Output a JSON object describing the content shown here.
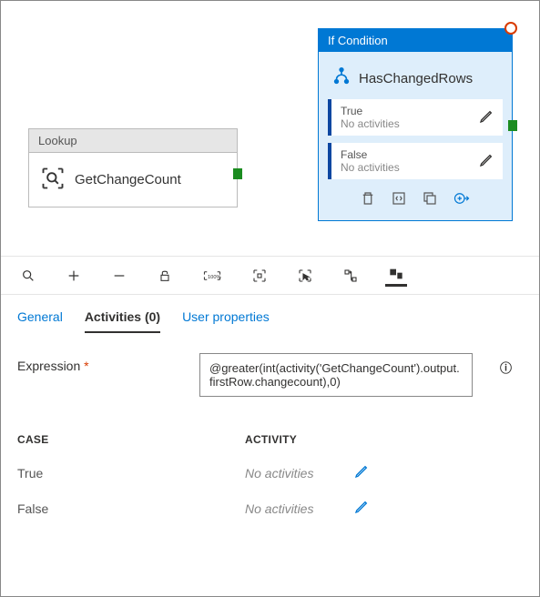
{
  "canvas": {
    "lookup": {
      "type_label": "Lookup",
      "name": "GetChangeCount"
    },
    "if_condition": {
      "type_label": "If Condition",
      "name": "HasChangedRows",
      "branches": [
        {
          "label": "True",
          "sub": "No activities"
        },
        {
          "label": "False",
          "sub": "No activities"
        }
      ]
    }
  },
  "tabs": {
    "general": "General",
    "activities": "Activities (0)",
    "user_properties": "User properties"
  },
  "expression": {
    "label": "Expression",
    "value": "@greater(int(activity('GetChangeCount').output.firstRow.changecount),0)"
  },
  "case_table": {
    "header_case": "CASE",
    "header_activity": "ACTIVITY",
    "rows": [
      {
        "case": "True",
        "activity": "No activities"
      },
      {
        "case": "False",
        "activity": "No activities"
      }
    ]
  }
}
